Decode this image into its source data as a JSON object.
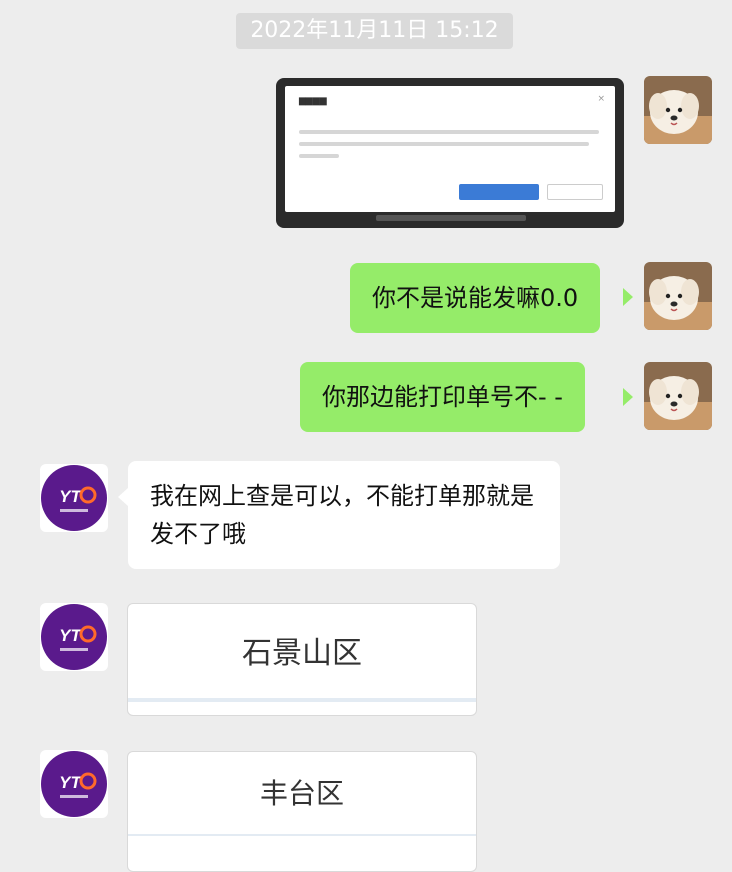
{
  "timestamp": "2022年11月11日 15:12",
  "messages": [
    {
      "side": "right",
      "type": "image",
      "icon": "dialog-screenshot"
    },
    {
      "side": "right",
      "type": "text",
      "text": "你不是说能发嘛0.0"
    },
    {
      "side": "right",
      "type": "text",
      "text": "你那边能打印单号不- -"
    },
    {
      "side": "left",
      "type": "text",
      "text": "我在网上查是可以，不能打单那就是发不了哦"
    },
    {
      "side": "left",
      "type": "card",
      "text": "石景山区"
    },
    {
      "side": "left",
      "type": "card",
      "text": "丰台区"
    }
  ],
  "avatars": {
    "me": {
      "icon": "dog-avatar",
      "bg": "#e9dcc8"
    },
    "contact": {
      "icon": "yto-logo-icon",
      "logo_text": "YTO",
      "accent": "#5a1a8c"
    }
  },
  "colors": {
    "background": "#ededed",
    "sent_bubble": "#95ec69",
    "received_bubble": "#ffffff"
  }
}
